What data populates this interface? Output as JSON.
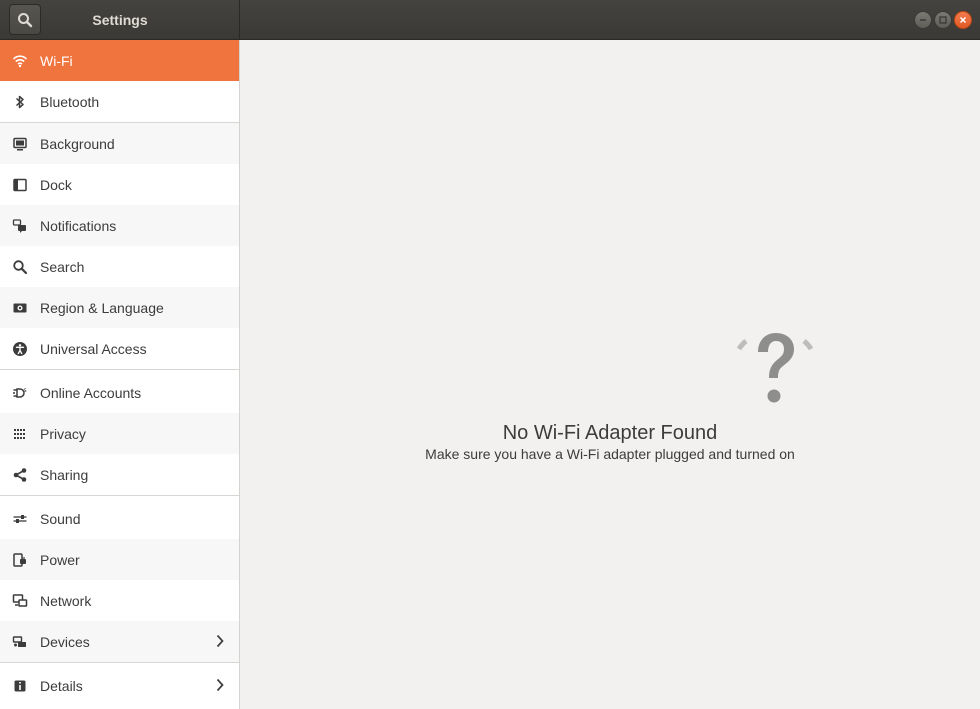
{
  "window": {
    "title": "Settings"
  },
  "colors": {
    "accent": "#f0743e",
    "header_bg": "#3c3b37",
    "close_button": "#e95420"
  },
  "header": {
    "search_icon": "search-icon",
    "window_buttons": [
      "minimize",
      "maximize",
      "close"
    ]
  },
  "sidebar": {
    "items": [
      {
        "label": "Wi-Fi",
        "icon": "wifi-icon",
        "active": true
      },
      {
        "label": "Bluetooth",
        "icon": "bluetooth-icon"
      },
      {
        "label": "Background",
        "icon": "background-icon"
      },
      {
        "label": "Dock",
        "icon": "dock-icon"
      },
      {
        "label": "Notifications",
        "icon": "notifications-icon"
      },
      {
        "label": "Search",
        "icon": "search-icon"
      },
      {
        "label": "Region & Language",
        "icon": "region-icon"
      },
      {
        "label": "Universal Access",
        "icon": "universal-access-icon"
      },
      {
        "label": "Online Accounts",
        "icon": "online-accounts-icon"
      },
      {
        "label": "Privacy",
        "icon": "privacy-icon"
      },
      {
        "label": "Sharing",
        "icon": "sharing-icon"
      },
      {
        "label": "Sound",
        "icon": "sound-icon"
      },
      {
        "label": "Power",
        "icon": "power-icon"
      },
      {
        "label": "Network",
        "icon": "network-icon"
      },
      {
        "label": "Devices",
        "icon": "devices-icon",
        "has_submenu": true
      },
      {
        "label": "Details",
        "icon": "details-icon",
        "has_submenu": true
      }
    ]
  },
  "main": {
    "empty_icon": "question-mark-icon",
    "empty_title": "No Wi-Fi Adapter Found",
    "empty_subtitle": "Make sure you have a Wi-Fi adapter plugged and turned on"
  }
}
